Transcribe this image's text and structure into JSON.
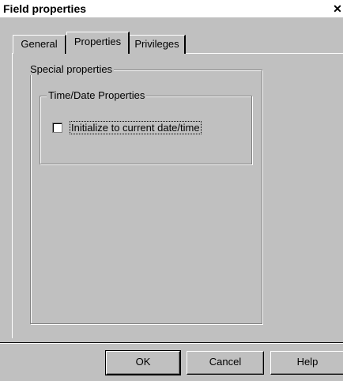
{
  "window": {
    "title": "Field properties",
    "close_label": "✕"
  },
  "tabs": [
    {
      "label": "General"
    },
    {
      "label": "Properties"
    },
    {
      "label": "Privileges"
    }
  ],
  "groups": {
    "special": {
      "label": "Special properties"
    },
    "time_date": {
      "label": "Time/Date Properties"
    }
  },
  "checkbox": {
    "label": "Initialize to current date/time",
    "checked": false
  },
  "buttons": {
    "ok": "OK",
    "cancel": "Cancel",
    "help": "Help"
  }
}
